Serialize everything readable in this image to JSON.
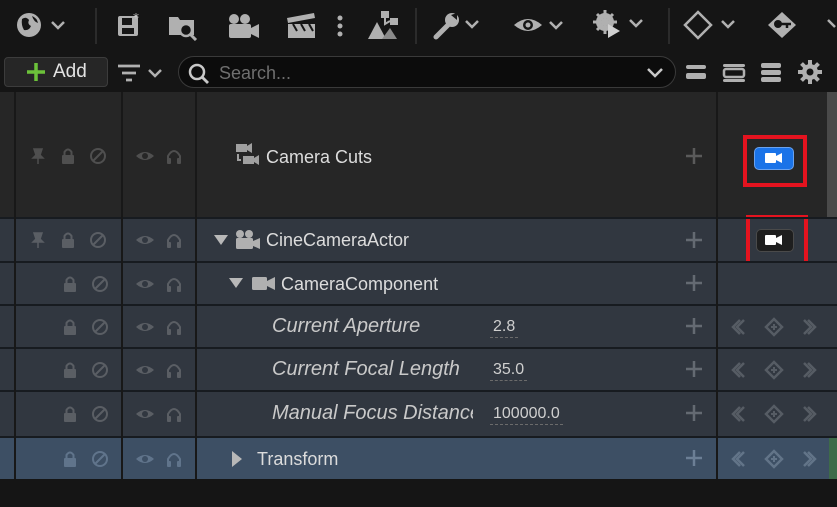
{
  "toolbar": {
    "items": [
      {
        "name": "world-icon",
        "dropdown": true
      },
      {
        "name": "save-icon"
      },
      {
        "name": "find-in-browser-icon"
      },
      {
        "name": "camera-actor-icon"
      },
      {
        "name": "clapperboard-icon"
      },
      {
        "name": "more-vertical-icon"
      },
      {
        "name": "hierarchy-icon"
      },
      {
        "name": "wrench-icon",
        "dropdown": true
      },
      {
        "name": "eye-icon",
        "dropdown": true
      },
      {
        "name": "play-settings-icon",
        "dropdown": true
      },
      {
        "name": "keyframe-diamond-icon",
        "dropdown": true
      },
      {
        "name": "key-icon"
      }
    ]
  },
  "actions": {
    "add_label": "Add",
    "search_placeholder": "Search..."
  },
  "tracks": [
    {
      "label": "Camera Cuts",
      "type": "camera-cuts",
      "camera_toggle": "active"
    },
    {
      "label": "CineCameraActor",
      "type": "actor",
      "expanded": true,
      "camera_toggle": "inactive"
    },
    {
      "label": "CameraComponent",
      "type": "component",
      "expanded": true
    },
    {
      "label": "Current Aperture",
      "type": "property",
      "value": "2.8"
    },
    {
      "label": "Current Focal Length",
      "type": "property",
      "value": "35.0"
    },
    {
      "label": "Manual Focus Distance",
      "type": "property",
      "value": "100000.0"
    },
    {
      "label": "Transform",
      "type": "transform",
      "expanded": false,
      "selected": true
    }
  ],
  "colors": {
    "accent_blue": "#1a73e8",
    "highlight_red": "#e4131f",
    "row_bg": "#313740",
    "selected_row_bg": "#3d4f64"
  }
}
